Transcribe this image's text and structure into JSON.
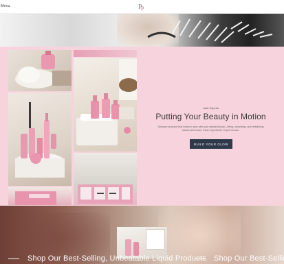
{
  "header": {
    "menu_text": "Menu",
    "logo_letters": "PP",
    "logo_color": "#c46a8b"
  },
  "feature": {
    "eyebrow": "Lash Experts",
    "headline": "Putting Your Beauty in Motion",
    "description": "Skincare products that works in sync with your natural beauty—lifting, smoothing, and revitalizing lashes and brows. Clean ingredients. Expert results.",
    "cta_label": "BUILD YOUR GLOW"
  },
  "marquee": {
    "text_1": "Shop Our Best-Selling, Unbeatable Liquid Products",
    "text_2": "Shop Our Best-Selling"
  },
  "colors": {
    "pink_band": "#f7d3dd",
    "cta_background": "#2e3a4a",
    "accent_pink": "#e9a0b4"
  },
  "icons": [
    "menu-icon",
    "brand-logo"
  ]
}
